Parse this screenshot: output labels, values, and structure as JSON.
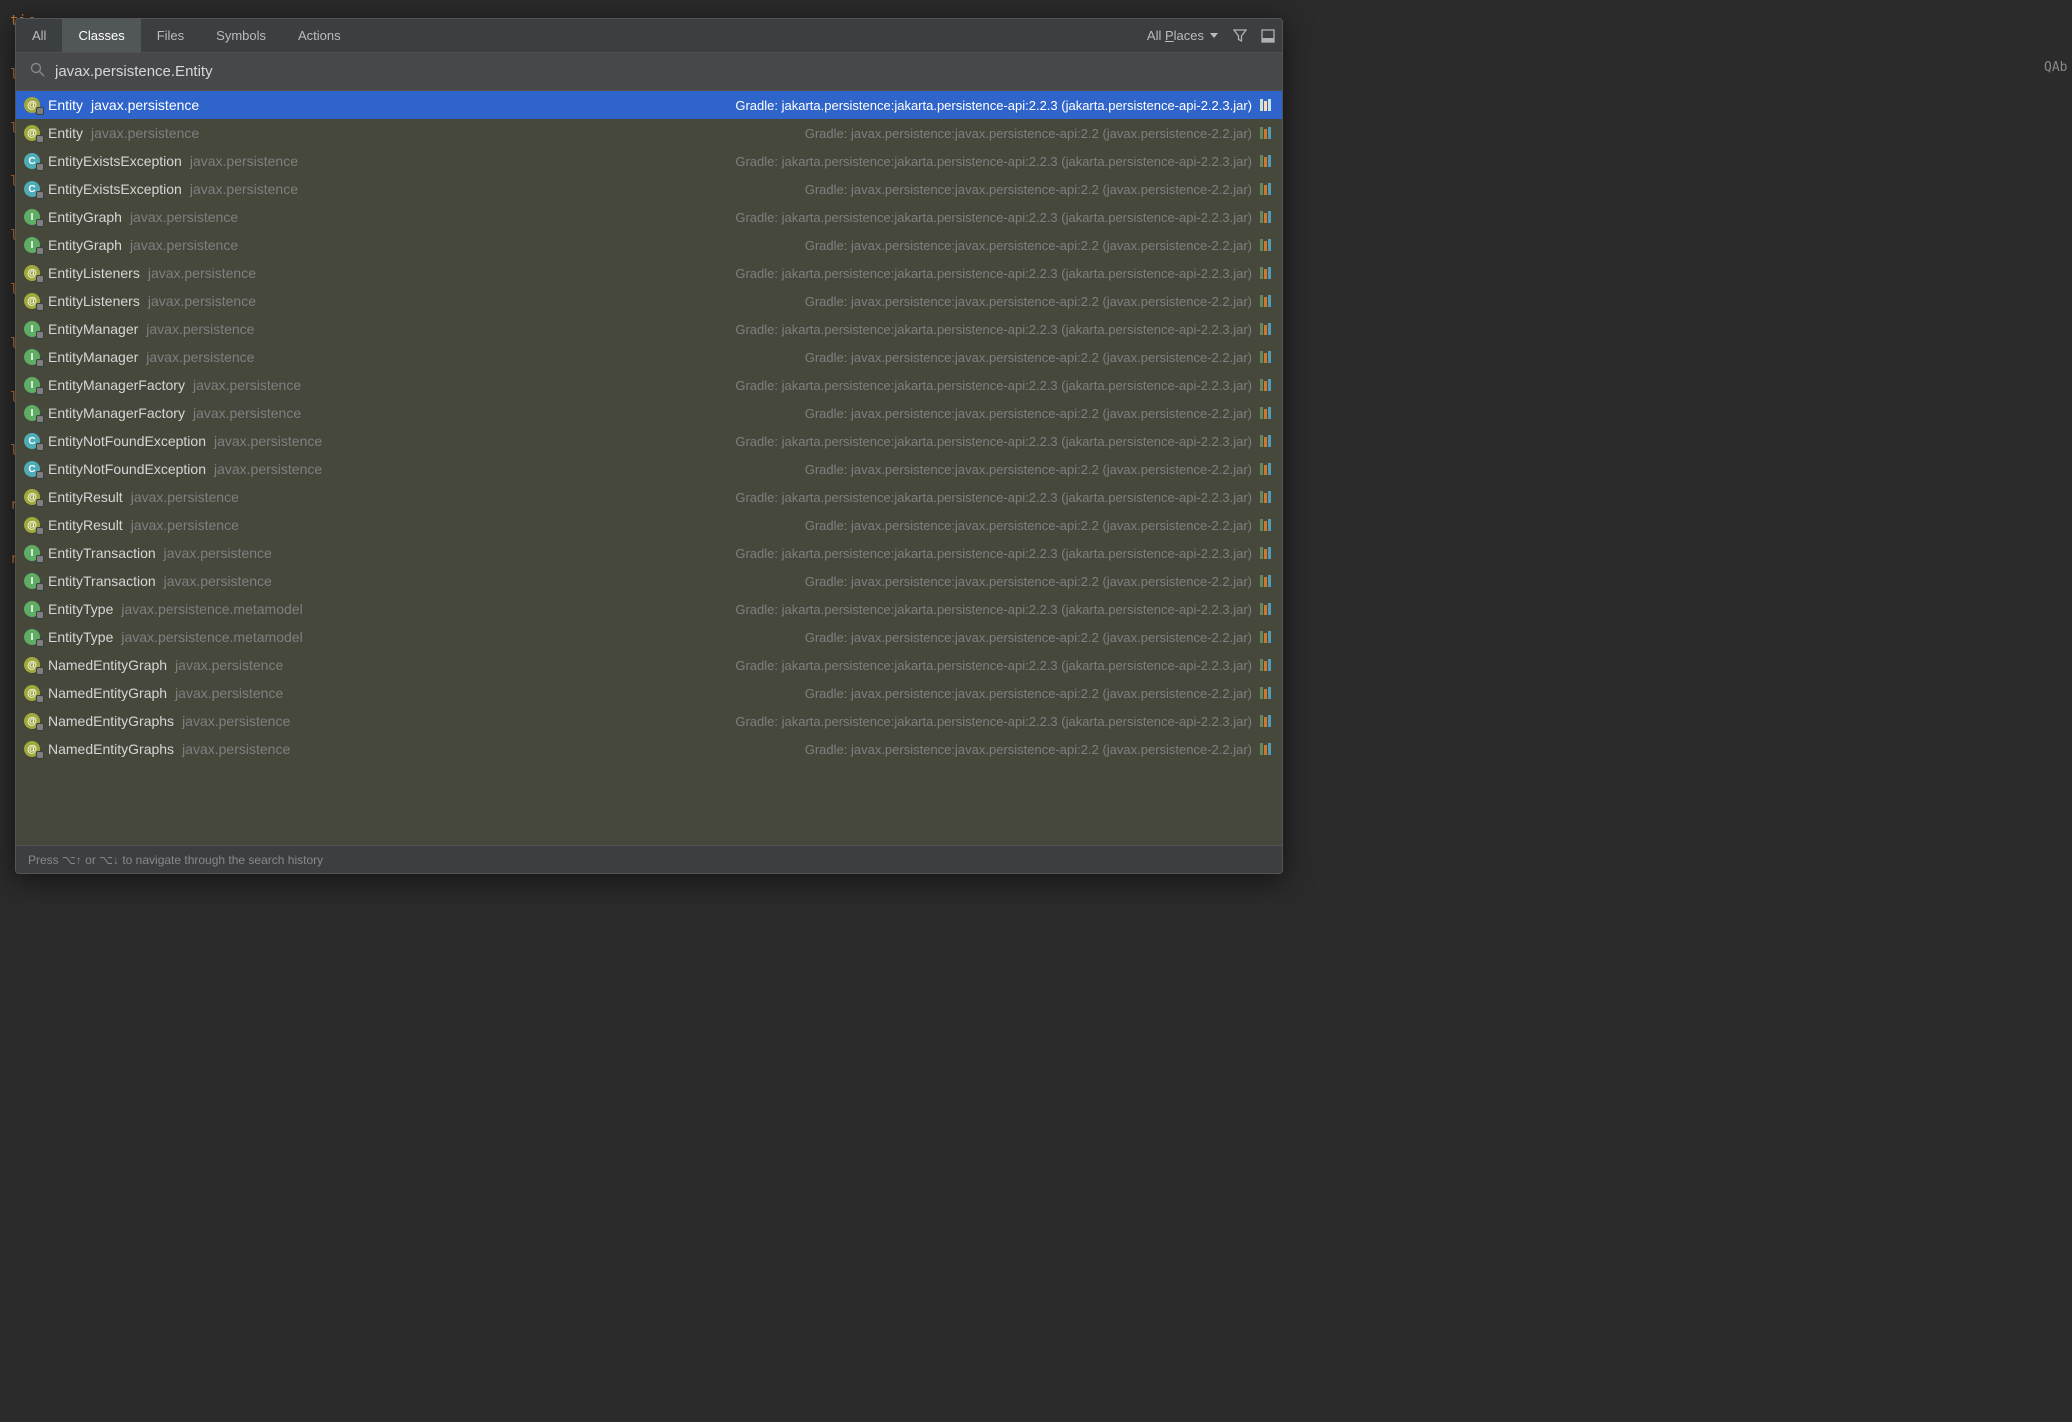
{
  "editor": {
    "fragments": [
      "tic",
      "l C",
      "l D",
      "l D",
      "l S",
      "l D",
      "l S",
      "l S",
      "l M",
      "r(S",
      "r(F"
    ],
    "right_clip": "QAb"
  },
  "tabs": {
    "all": "All",
    "classes": "Classes",
    "files": "Files",
    "symbols": "Symbols",
    "actions": "Actions"
  },
  "scope": {
    "prefix": "All ",
    "mnemonic": "P",
    "suffix": "laces"
  },
  "search": {
    "value": "javax.persistence.Entity"
  },
  "loc": {
    "a": "Gradle: jakarta.persistence:jakarta.persistence-api:2.2.3 (jakarta.persistence-api-2.2.3.jar)",
    "b": "Gradle: javax.persistence:javax.persistence-api:2.2 (javax.persistence-2.2.jar)"
  },
  "results": [
    {
      "icon": "a",
      "name": "Entity",
      "pkg": "javax.persistence",
      "loc": "a",
      "selected": true
    },
    {
      "icon": "a",
      "name": "Entity",
      "pkg": "javax.persistence",
      "loc": "b"
    },
    {
      "icon": "c",
      "name": "EntityExistsException",
      "pkg": "javax.persistence",
      "loc": "a"
    },
    {
      "icon": "c",
      "name": "EntityExistsException",
      "pkg": "javax.persistence",
      "loc": "b"
    },
    {
      "icon": "i",
      "name": "EntityGraph",
      "pkg": "javax.persistence",
      "loc": "a"
    },
    {
      "icon": "i",
      "name": "EntityGraph",
      "pkg": "javax.persistence",
      "loc": "b"
    },
    {
      "icon": "a",
      "name": "EntityListeners",
      "pkg": "javax.persistence",
      "loc": "a"
    },
    {
      "icon": "a",
      "name": "EntityListeners",
      "pkg": "javax.persistence",
      "loc": "b"
    },
    {
      "icon": "i",
      "name": "EntityManager",
      "pkg": "javax.persistence",
      "loc": "a"
    },
    {
      "icon": "i",
      "name": "EntityManager",
      "pkg": "javax.persistence",
      "loc": "b"
    },
    {
      "icon": "i",
      "name": "EntityManagerFactory",
      "pkg": "javax.persistence",
      "loc": "a"
    },
    {
      "icon": "i",
      "name": "EntityManagerFactory",
      "pkg": "javax.persistence",
      "loc": "b"
    },
    {
      "icon": "c",
      "name": "EntityNotFoundException",
      "pkg": "javax.persistence",
      "loc": "a"
    },
    {
      "icon": "c",
      "name": "EntityNotFoundException",
      "pkg": "javax.persistence",
      "loc": "b"
    },
    {
      "icon": "a",
      "name": "EntityResult",
      "pkg": "javax.persistence",
      "loc": "a"
    },
    {
      "icon": "a",
      "name": "EntityResult",
      "pkg": "javax.persistence",
      "loc": "b"
    },
    {
      "icon": "i",
      "name": "EntityTransaction",
      "pkg": "javax.persistence",
      "loc": "a"
    },
    {
      "icon": "i",
      "name": "EntityTransaction",
      "pkg": "javax.persistence",
      "loc": "b"
    },
    {
      "icon": "i",
      "name": "EntityType",
      "pkg": "javax.persistence.metamodel",
      "loc": "a"
    },
    {
      "icon": "i",
      "name": "EntityType",
      "pkg": "javax.persistence.metamodel",
      "loc": "b"
    },
    {
      "icon": "a",
      "name": "NamedEntityGraph",
      "pkg": "javax.persistence",
      "loc": "a"
    },
    {
      "icon": "a",
      "name": "NamedEntityGraph",
      "pkg": "javax.persistence",
      "loc": "b"
    },
    {
      "icon": "a",
      "name": "NamedEntityGraphs",
      "pkg": "javax.persistence",
      "loc": "a"
    },
    {
      "icon": "a",
      "name": "NamedEntityGraphs",
      "pkg": "javax.persistence",
      "loc": "b"
    }
  ],
  "footer": {
    "hint": "Press ⌥↑ or ⌥↓ to navigate through the search history"
  },
  "icon_letters": {
    "a": "@",
    "c": "C",
    "i": "I"
  }
}
